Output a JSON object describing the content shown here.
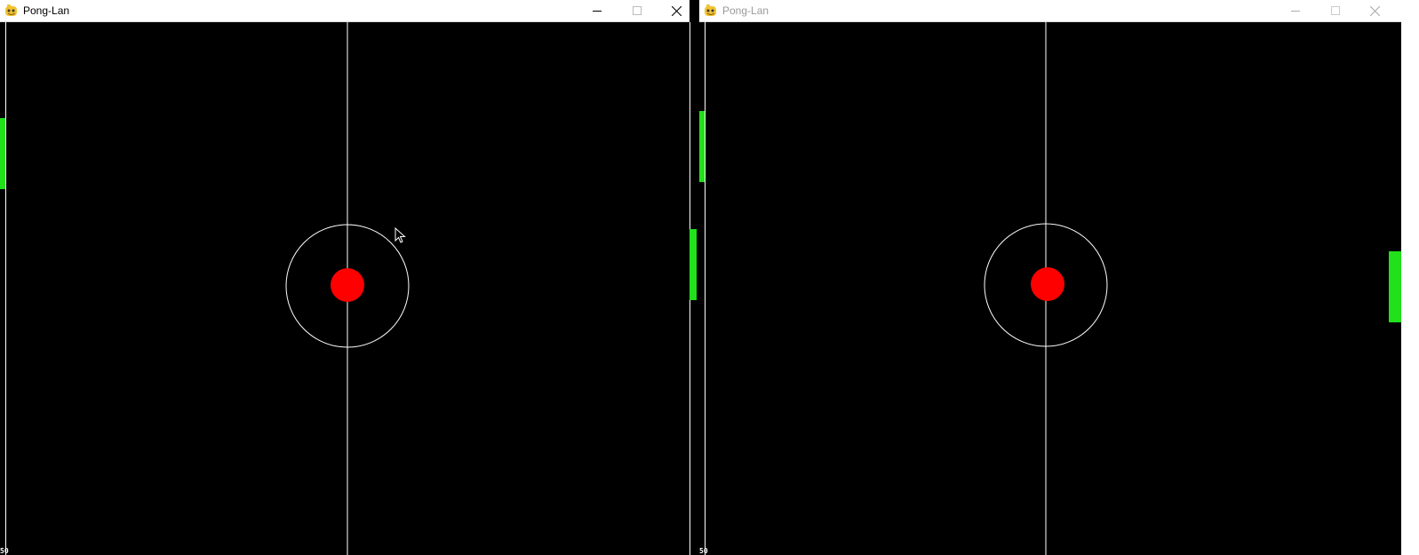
{
  "colors": {
    "paddle": "#22e01a",
    "ball": "#ff0000",
    "field": "#000000",
    "lines": "#ffffff"
  },
  "windows": [
    {
      "title": "Pong-Lan",
      "active": true,
      "score": "50",
      "icon": "pygame-snake-icon",
      "buttons": [
        "minimize-icon",
        "maximize-icon",
        "close-icon"
      ]
    },
    {
      "title": "Pong-Lan",
      "active": false,
      "score": "50",
      "icon": "pygame-snake-icon",
      "buttons": [
        "minimize-icon",
        "maximize-icon",
        "close-icon"
      ]
    }
  ],
  "pointer": "arrow-cursor-icon"
}
